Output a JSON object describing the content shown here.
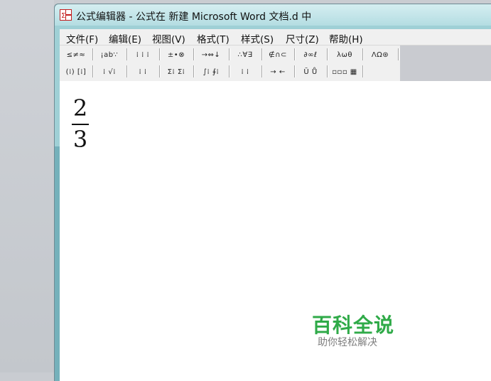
{
  "window": {
    "title": "公式编辑器 - 公式在 新建 Microsoft Word 文档.d 中"
  },
  "menu": [
    "文件(F)",
    "编辑(E)",
    "视图(V)",
    "格式(T)",
    "样式(S)",
    "尺寸(Z)",
    "帮助(H)"
  ],
  "toolbar": {
    "row1": [
      "≤≠≈",
      "¡ab∵",
      "⁞ ⁞ ⁞",
      "±•⊗",
      "→⇔↓",
      "∴∀∃",
      "∉∩⊂",
      "∂∞ℓ",
      "λωθ",
      "ΛΩ⊛"
    ],
    "row2": [
      "(⁞) [⁞]",
      "⁞ √⁞",
      "⁞ ⁞",
      "Σ⁞ Σ⁞",
      "∫⁞ ∮⁞",
      "⁞ ⁞",
      "→ ←",
      "Ū Ů",
      "▫▫▫ ▦"
    ]
  },
  "equation": {
    "numerator": "2",
    "denominator": "3"
  },
  "watermark": {
    "main": "百科全说",
    "sub": "助你轻松解决"
  },
  "colors": {
    "title_bar": "#b4dde2",
    "watermark_green": "#2faa48"
  }
}
